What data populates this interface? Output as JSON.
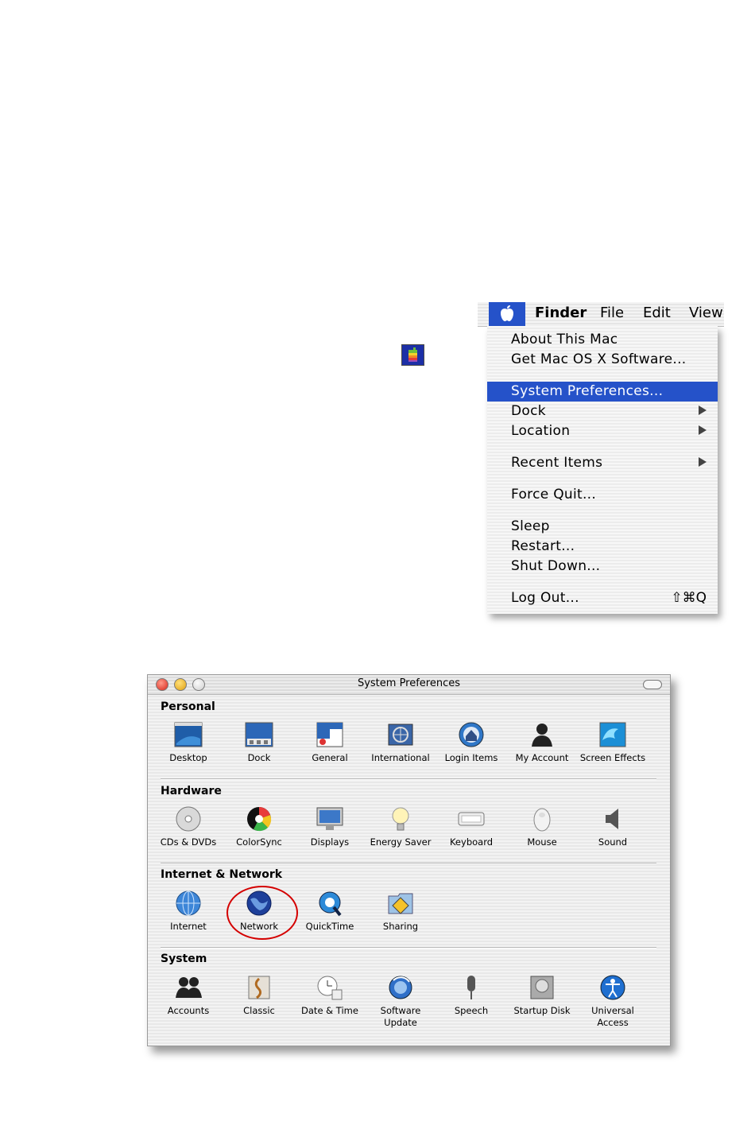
{
  "apple_menu": {
    "menubar_items": [
      "Finder",
      "File",
      "Edit",
      "View"
    ],
    "items": [
      {
        "label": "About This Mac"
      },
      {
        "label": "Get Mac OS X Software..."
      },
      {
        "label": "System Preferences...",
        "highlighted": true
      },
      {
        "label": "Dock",
        "submenu": true
      },
      {
        "label": "Location",
        "submenu": true
      },
      {
        "label": "Recent Items",
        "submenu": true
      },
      {
        "label": "Force Quit..."
      },
      {
        "label": "Sleep"
      },
      {
        "label": "Restart..."
      },
      {
        "label": "Shut Down..."
      },
      {
        "label": "Log Out...",
        "shortcut": "⇧⌘Q"
      }
    ]
  },
  "system_preferences": {
    "title": "System Preferences",
    "sections": [
      {
        "title": "Personal",
        "items": [
          "Desktop",
          "Dock",
          "General",
          "International",
          "Login Items",
          "My Account",
          "Screen Effects"
        ]
      },
      {
        "title": "Hardware",
        "items": [
          "CDs & DVDs",
          "ColorSync",
          "Displays",
          "Energy Saver",
          "Keyboard",
          "Mouse",
          "Sound"
        ]
      },
      {
        "title": "Internet & Network",
        "items": [
          "Internet",
          "Network",
          "QuickTime",
          "Sharing"
        ]
      },
      {
        "title": "System",
        "items": [
          "Accounts",
          "Classic",
          "Date & Time",
          "Software Update",
          "Speech",
          "Startup Disk",
          "Universal Access"
        ]
      }
    ],
    "highlighted_item": "Network"
  },
  "colors": {
    "highlight": "#2552c9",
    "annotation_circle": "#d40000"
  }
}
